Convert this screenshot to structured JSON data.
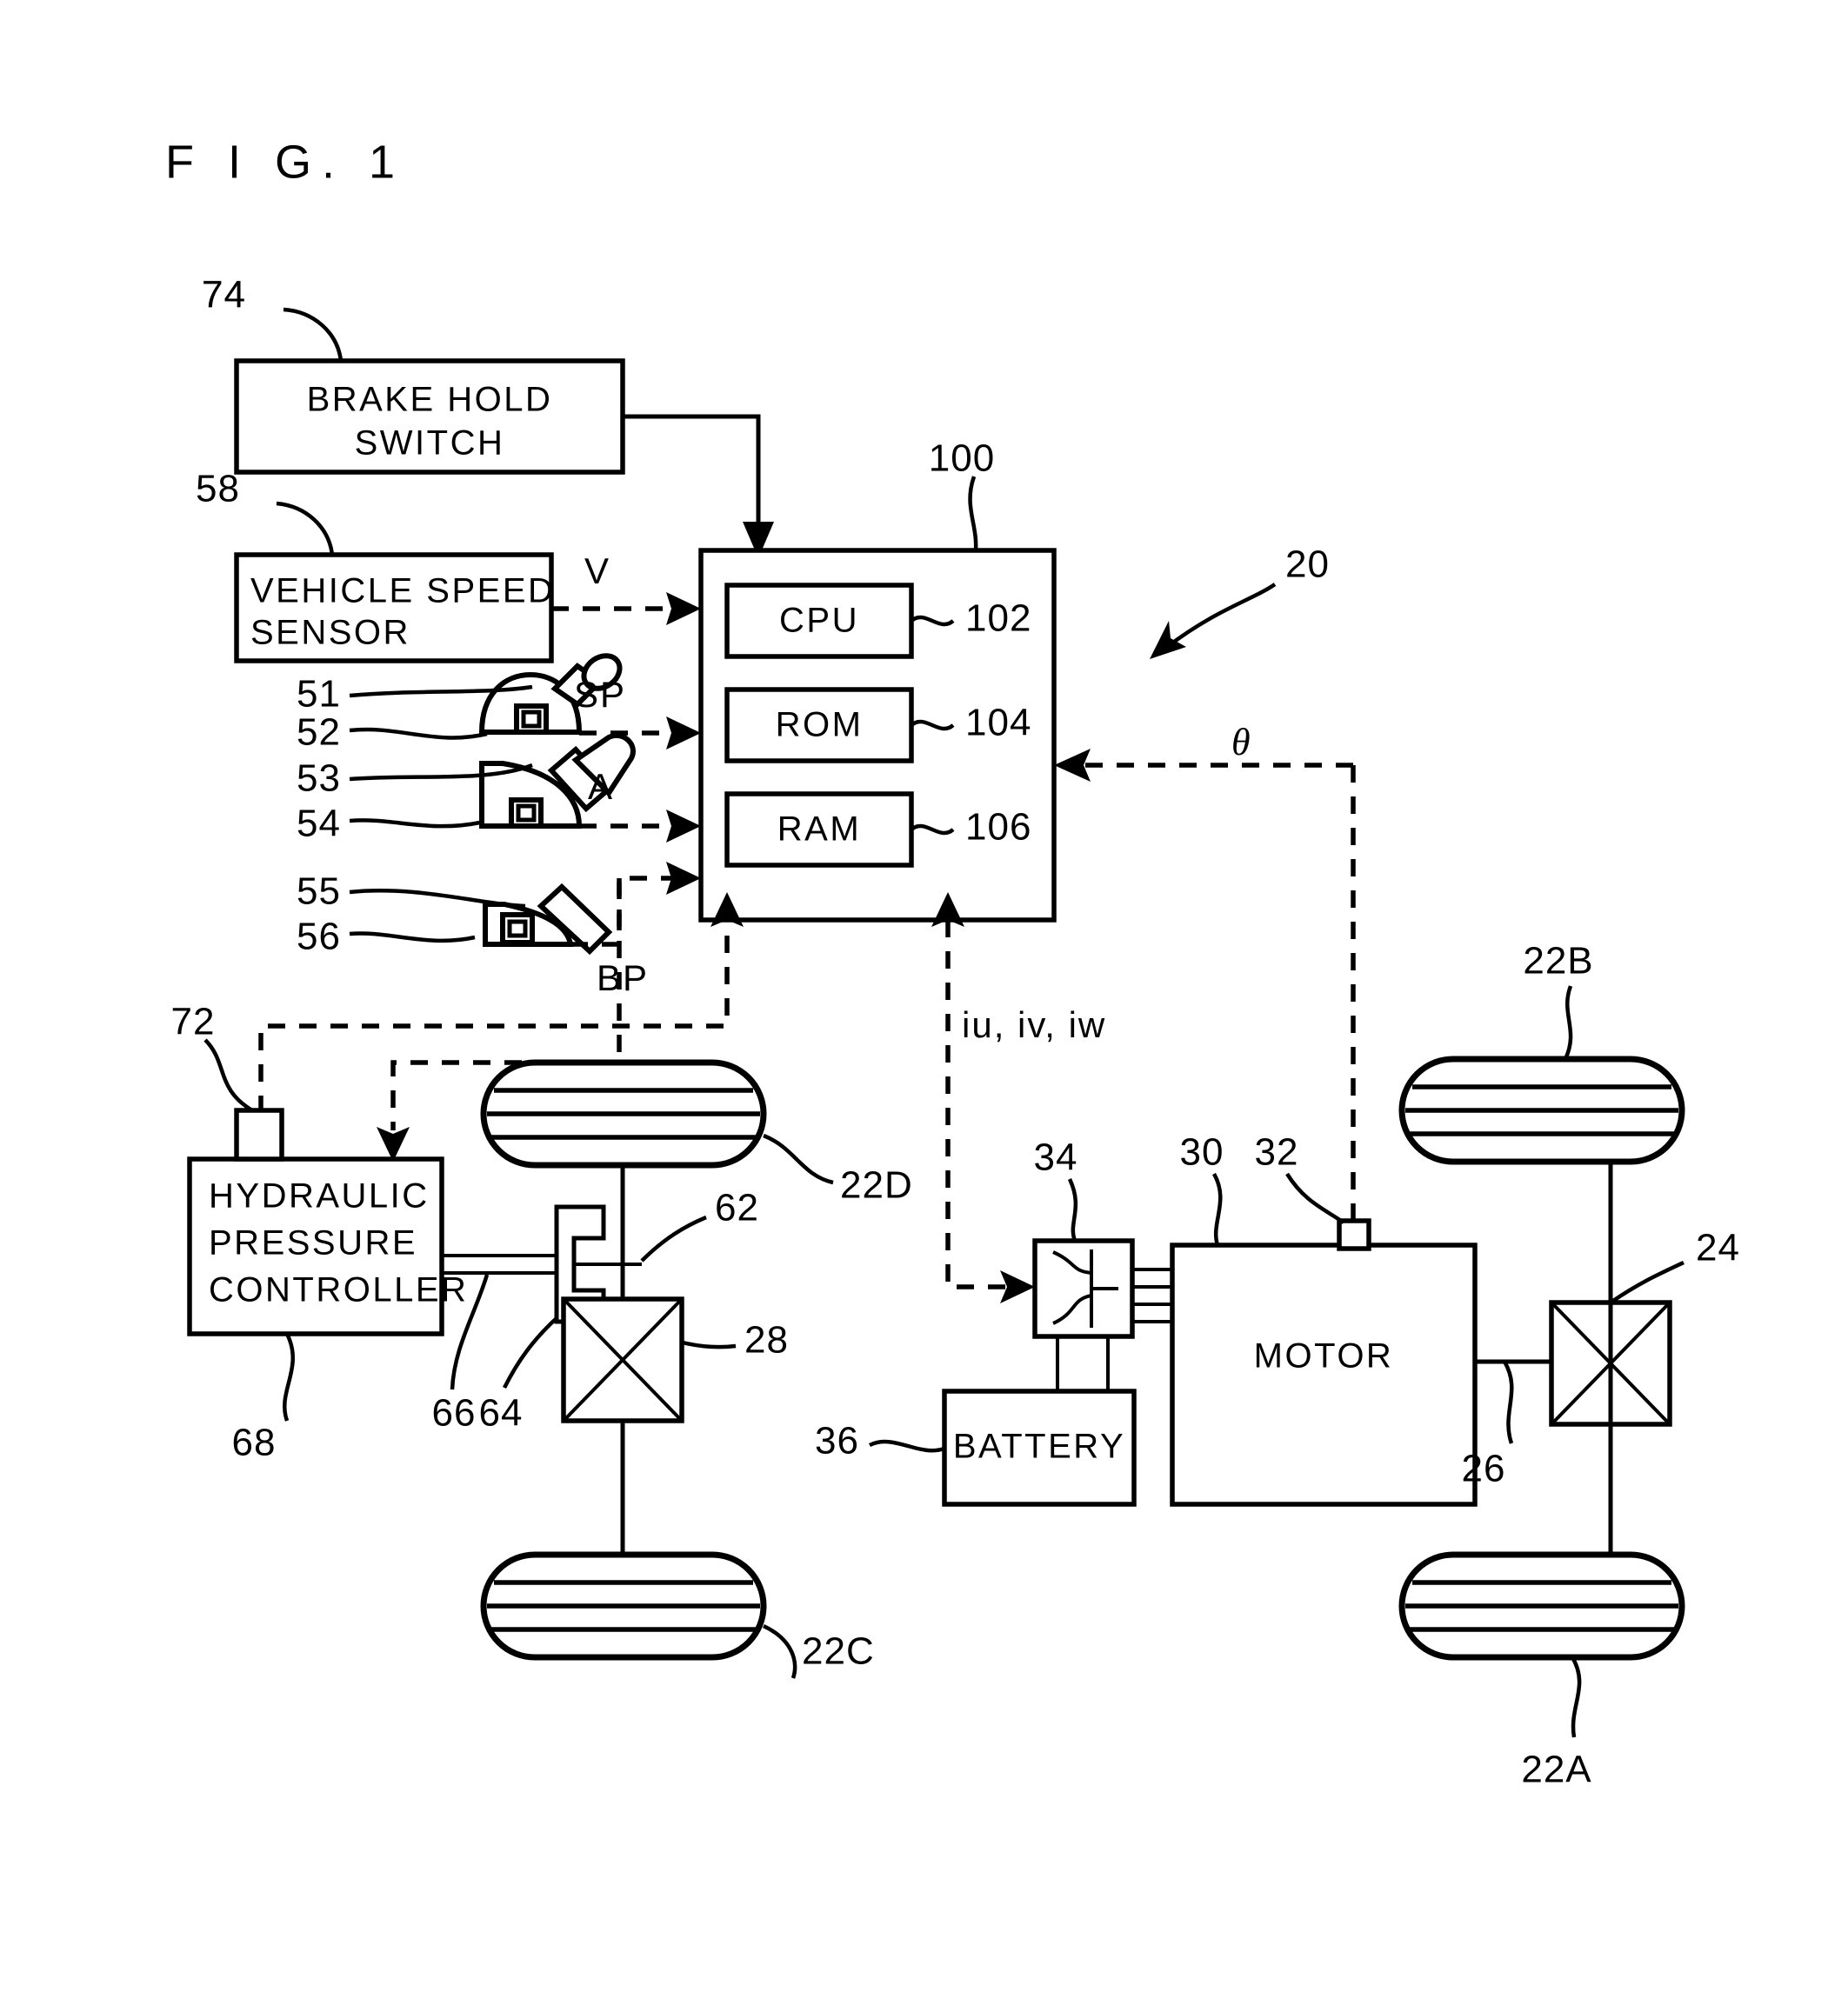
{
  "figure": {
    "title": "F I G.  1"
  },
  "blocks": [
    {
      "id": "brake-hold-switch",
      "lines": [
        "BRAKE HOLD",
        "SWITCH"
      ],
      "ref": "74"
    },
    {
      "id": "vehicle-speed-sensor",
      "lines": [
        "VEHICLE SPEED",
        "SENSOR"
      ],
      "ref": "58"
    },
    {
      "id": "ecu",
      "lines": [],
      "ref": "100"
    },
    {
      "id": "cpu",
      "lines": [
        "CPU"
      ],
      "ref": "102"
    },
    {
      "id": "rom",
      "lines": [
        "ROM"
      ],
      "ref": "104"
    },
    {
      "id": "ram",
      "lines": [
        "RAM"
      ],
      "ref": "106"
    },
    {
      "id": "hydraulic-pressure-controller",
      "lines": [
        "HYDRAULIC",
        "PRESSURE",
        "CONTROLLER"
      ],
      "ref": "68"
    },
    {
      "id": "motor",
      "lines": [
        "MOTOR"
      ],
      "ref": "30"
    },
    {
      "id": "battery",
      "lines": [
        "BATTERY"
      ],
      "ref": "36"
    },
    {
      "id": "inverter",
      "lines": [],
      "ref": "34"
    }
  ],
  "block_text": {
    "brake_hold_switch_l1": "BRAKE HOLD",
    "brake_hold_switch_l2": "SWITCH",
    "vehicle_speed_sensor_l1": "VEHICLE SPEED",
    "vehicle_speed_sensor_l2": "SENSOR",
    "cpu": "CPU",
    "rom": "ROM",
    "ram": "RAM",
    "hydraulic_l1": "HYDRAULIC",
    "hydraulic_l2": "PRESSURE",
    "hydraulic_l3": "CONTROLLER",
    "motor": "MOTOR",
    "battery": "BATTERY"
  },
  "signal_labels": {
    "vehicle_speed": "V",
    "shift_position": "SP",
    "accelerator": "A",
    "brake_pedal": "BP",
    "motor_currents": "iu, iv, iw",
    "resolver_angle": "θ"
  },
  "reference_numerals": {
    "brake_hold_switch": "74",
    "vehicle_speed_sensor": "58",
    "shift_lever": "51",
    "shift_position_sensor": "52",
    "accelerator_pedal": "53",
    "accelerator_pedal_sensor": "54",
    "brake_pedal": "55",
    "brake_pedal_sensor": "56",
    "ecu": "100",
    "cpu": "102",
    "rom": "104",
    "ram": "106",
    "vehicle": "20",
    "wheel_front_right": "22A",
    "wheel_front_left": "22B",
    "wheel_rear_left": "22C",
    "wheel_rear_right": "22D",
    "front_differential": "24",
    "front_drive_shaft": "26",
    "rear_axle": "28",
    "motor": "30",
    "resolver": "32",
    "inverter": "34",
    "battery": "36",
    "brake_disc": "62",
    "brake_caliper": "64",
    "brake_line": "66",
    "hydraulic_pressure_controller": "68",
    "hydraulic_pressure_sensor": "72"
  }
}
